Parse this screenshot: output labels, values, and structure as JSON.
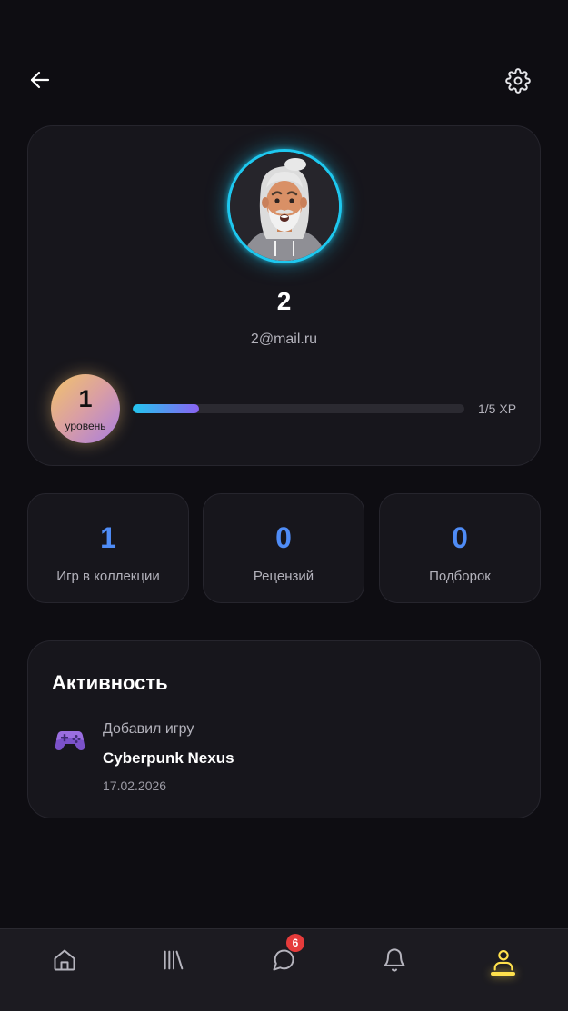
{
  "topbar": {
    "back_icon": "arrow-left-icon",
    "settings_icon": "gear-icon"
  },
  "profile": {
    "name": "2",
    "email": "2@mail.ru",
    "level": {
      "number": "1",
      "label": "уровень"
    },
    "xp": {
      "text": "1/5 XP",
      "progress": 0.2
    }
  },
  "stats": [
    {
      "value": "1",
      "label": "Игр в коллекции"
    },
    {
      "value": "0",
      "label": "Рецензий"
    },
    {
      "value": "0",
      "label": "Подборок"
    }
  ],
  "activity": {
    "title": "Активность",
    "items": [
      {
        "icon": "gamepad-icon",
        "action": "Добавил игру",
        "game": "Cyberpunk Nexus",
        "date": "17.02.2026"
      }
    ]
  },
  "bottom_nav": {
    "items": [
      {
        "icon": "home-icon",
        "active": false
      },
      {
        "icon": "library-icon",
        "active": false
      },
      {
        "icon": "chat-icon",
        "active": false,
        "badge": "6"
      },
      {
        "icon": "bell-icon",
        "active": false
      },
      {
        "icon": "profile-icon",
        "active": true
      }
    ]
  },
  "colors": {
    "background": "#0e0d12",
    "card": "#17161c",
    "accent_cyan": "#1ec8ef",
    "stat_blue": "#4f8cf6",
    "active_yellow": "#ffe14d",
    "badge_red": "#e53b3b"
  }
}
